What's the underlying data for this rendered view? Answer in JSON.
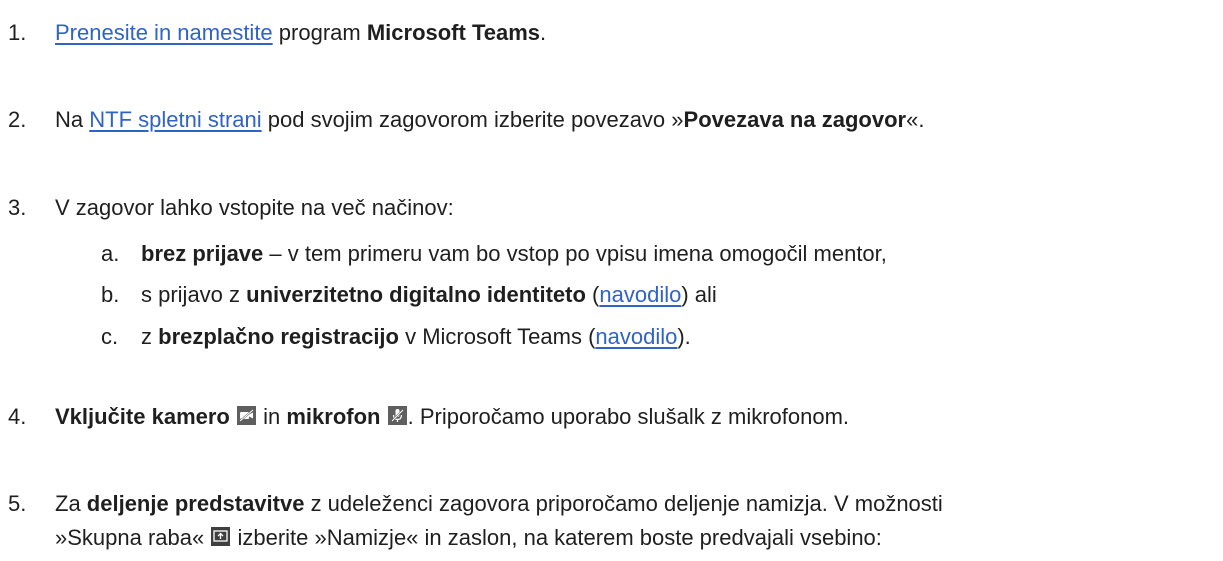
{
  "items": {
    "i1": {
      "num": "1.",
      "link": "Prenesite in namestite",
      "t1": " program ",
      "b1": "Microsoft Teams",
      "t2": "."
    },
    "i2": {
      "num": "2.",
      "t0": "Na ",
      "link": "NTF spletni strani",
      "t1": " pod svojim zagovorom izberite povezavo »",
      "b1": "Povezava na zagovor",
      "t2": "«."
    },
    "i3": {
      "num": "3.",
      "text": "V zagovor lahko vstopite na več načinov:",
      "a": {
        "mark": "a.",
        "b1": "brez prijave",
        "t1": " – v tem primeru vam bo vstop po vpisu imena omogočil mentor,"
      },
      "b": {
        "mark": "b.",
        "t0": "s prijavo z ",
        "b1": "univerzitetno digitalno identiteto",
        "t1": " (",
        "link": "navodilo",
        "t2": ") ali"
      },
      "c": {
        "mark": "c.",
        "t0": "z ",
        "b1": "brezplačno registracijo",
        "t1": " v Microsoft Teams (",
        "link": "navodilo",
        "t2": ")."
      }
    },
    "i4": {
      "num": "4.",
      "b1": "Vključite kamero",
      "t1": " in ",
      "b2": "mikrofon",
      "t2": ". Priporočamo uporabo slušalk z mikrofonom."
    },
    "i5": {
      "num": "5.",
      "t0": "Za ",
      "b1": "deljenje predstavitve",
      "t1": " z udeleženci zagovora priporočamo deljenje namizja. V možnosti",
      "l2a": "»Skupna raba« ",
      "l2b": " izberite »Namizje« in zaslon, na katerem boste predvajali vsebino:"
    }
  },
  "colors": {
    "link": "#2f63c5",
    "text": "#1f1f1f",
    "icon_bg": "#5f5f5f"
  },
  "icons": [
    "camera-off-icon",
    "mic-off-icon",
    "share-screen-icon"
  ]
}
